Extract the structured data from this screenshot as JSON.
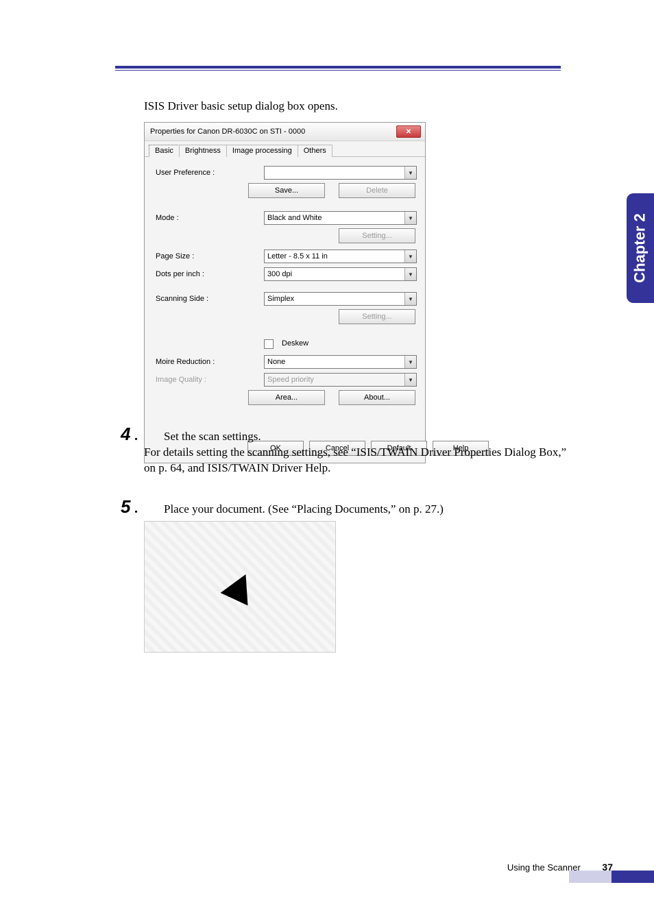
{
  "intro": "ISIS Driver basic setup dialog box opens.",
  "dialog": {
    "title": "Properties for Canon DR-6030C on STI - 0000",
    "close": "✕",
    "tabs": [
      "Basic",
      "Brightness",
      "Image processing",
      "Others"
    ],
    "labels": {
      "user_pref": "User Preference :",
      "mode": "Mode :",
      "page_size": "Page Size :",
      "dpi": "Dots per inch :",
      "scanning_side": "Scanning Side :",
      "deskew": "Deskew",
      "moire": "Moire Reduction :",
      "image_quality": "Image Quality :"
    },
    "values": {
      "user_pref": "",
      "mode": "Black and White",
      "page_size": "Letter - 8.5 x 11 in",
      "dpi": "300 dpi",
      "scanning_side": "Simplex",
      "moire": "None",
      "image_quality": "Speed priority"
    },
    "buttons": {
      "save": "Save...",
      "delete": "Delete",
      "setting1": "Setting...",
      "setting2": "Setting...",
      "area": "Area...",
      "about": "About..."
    },
    "footer_buttons": {
      "ok": "OK",
      "cancel": "Cancel",
      "default": "Default",
      "help": "Help"
    }
  },
  "steps": {
    "s4_num": "4",
    "s4_line1": "Set the scan settings.",
    "s4_line2": "For details setting the scanning settings, see “ISIS/TWAIN Driver Properties Dialog Box,” on p. 64, and ISIS/TWAIN Driver Help.",
    "s5_num": "5",
    "s5_line1": "Place your document. (See “Placing Documents,” on p. 27.)"
  },
  "side_tab": "Chapter 2",
  "footer": {
    "section": "Using the Scanner",
    "page": "37"
  }
}
